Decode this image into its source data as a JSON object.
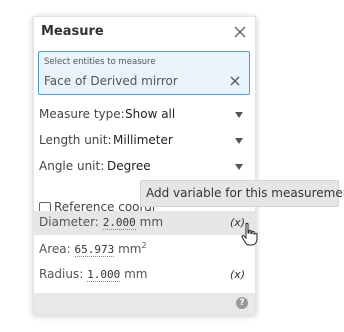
{
  "panel": {
    "title": "Measure",
    "selection": {
      "label": "Select entities to measure",
      "value": "Face of Derived mirror"
    },
    "measure_type": {
      "label": "Measure type:",
      "value": "Show all"
    },
    "length_unit": {
      "label": "Length unit:",
      "value": "Millimeter"
    },
    "angle_unit": {
      "label": "Angle unit:",
      "value": "Degree"
    },
    "reference_checkbox": {
      "label": "Reference coordinate system",
      "checked": false
    },
    "results": [
      {
        "label": "Diameter:",
        "value": "2.000",
        "unit": "mm"
      },
      {
        "label": "Area:",
        "value": "65.973",
        "unit": "mm",
        "superscript": "2"
      },
      {
        "label": "Radius:",
        "value": "1.000",
        "unit": "mm"
      }
    ],
    "variable_icon_text": "(x)"
  },
  "tooltip": {
    "text": "Add variable for this measurement"
  },
  "colors": {
    "selection_bg": "#e8f3fb",
    "selection_border": "#4f9fd6",
    "highlight_row": "#e6e6e6"
  },
  "icons": [
    "close-icon",
    "clear-icon",
    "caret-down-icon",
    "variable-icon",
    "help-icon",
    "hand-cursor-icon"
  ]
}
